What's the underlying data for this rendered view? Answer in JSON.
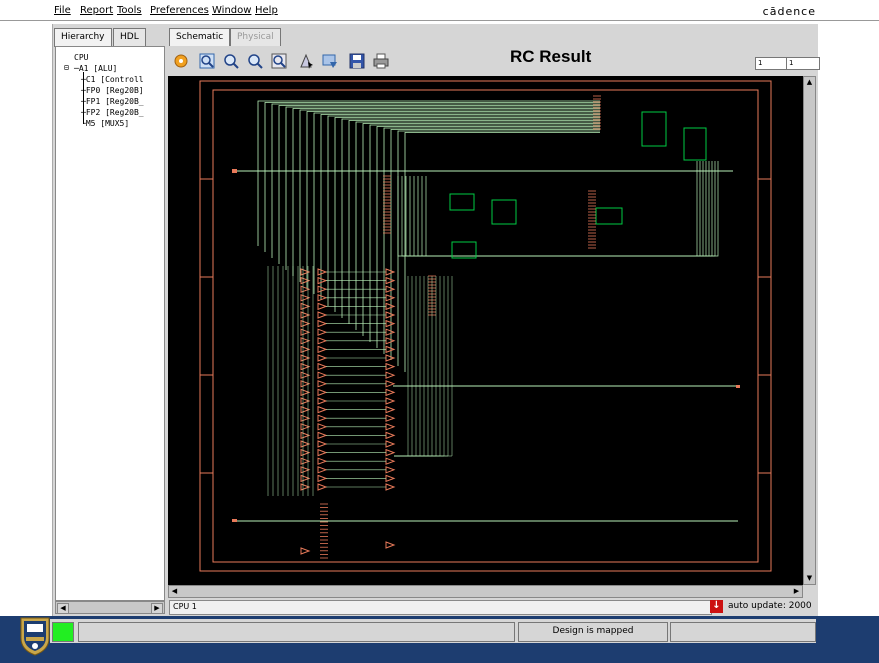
{
  "menu": {
    "items": [
      "File",
      "Report",
      "Tools",
      "Preferences",
      "Window",
      "Help"
    ],
    "brand": "cādence"
  },
  "left_tabs": [
    "Hierarchy",
    "HDL"
  ],
  "view_tabs": {
    "schematic": "Schematic",
    "physical": "Physical"
  },
  "tree": {
    "root": "CPU",
    "nodes": [
      "A1 [ALU]",
      "C1 [Controll",
      "FP0 [Reg20B]",
      "FP1 [Reg20B_",
      "FP2 [Reg20B_",
      "M5 [MUX5]"
    ]
  },
  "toolbar": {
    "icons": [
      "home-icon",
      "zoom-fit-icon",
      "zoom-in-icon",
      "zoom-out-icon",
      "zoom-area-icon",
      "select-icon",
      "filter-icon",
      "save-icon",
      "print-icon"
    ]
  },
  "title": "RC Result",
  "page": {
    "current": "1",
    "total": "1"
  },
  "status": {
    "cpu_field": "CPU 1",
    "auto_update": "auto update: 2000",
    "design_state": "Design is mapped"
  },
  "colors": {
    "canvas": "#000000",
    "wire": "#b8f0b8",
    "instance": "#e87a5a",
    "cell": "#00cc44",
    "footer": "#1d3d70",
    "indicator": "#22ee22"
  }
}
